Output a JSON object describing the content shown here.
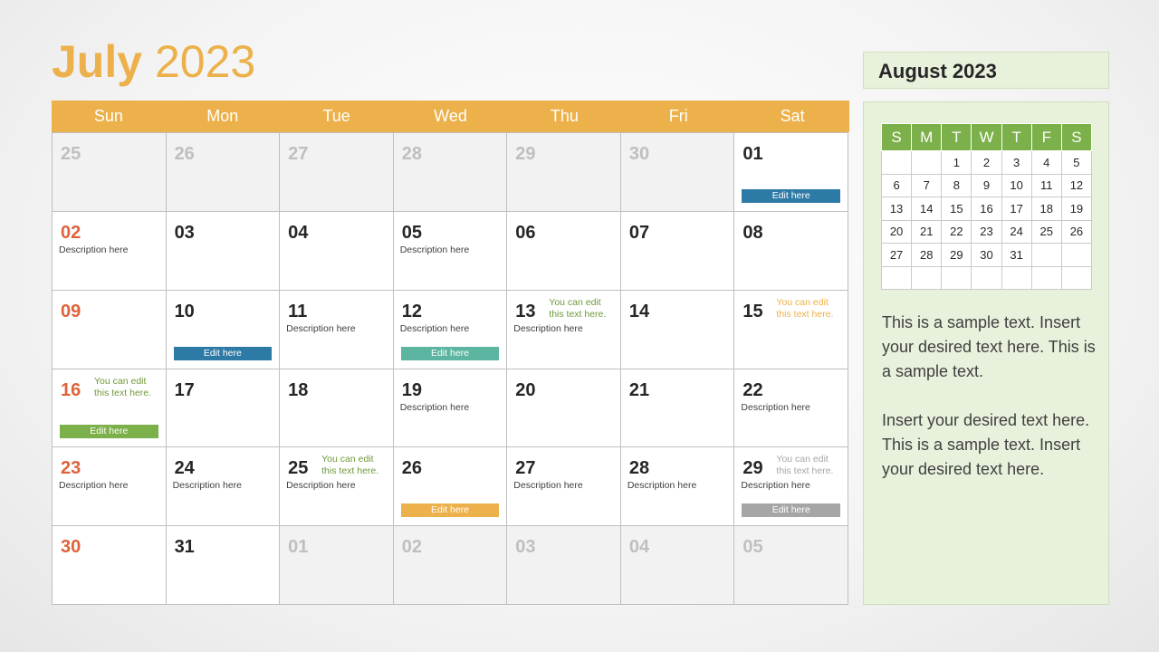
{
  "title": {
    "month": "July",
    "year": "2023"
  },
  "weekdays": [
    "Sun",
    "Mon",
    "Tue",
    "Wed",
    "Thu",
    "Fri",
    "Sat"
  ],
  "colors": {
    "orange": "#ecb14a",
    "sunday": "#e0623a",
    "blue": "#2e7aa6",
    "teal": "#5cb5a0",
    "green": "#7cb04a",
    "gray": "#a6a6a6",
    "note_green": "#6f9a3a",
    "note_orange": "#ecb14a",
    "note_gray": "#a6a6a6"
  },
  "calendar": {
    "weeks": [
      [
        {
          "day": "25",
          "other": true
        },
        {
          "day": "26",
          "other": true
        },
        {
          "day": "27",
          "other": true
        },
        {
          "day": "28",
          "other": true
        },
        {
          "day": "29",
          "other": true
        },
        {
          "day": "30",
          "other": true
        },
        {
          "day": "01",
          "edit": "Edit here",
          "edit_color": "blue"
        }
      ],
      [
        {
          "day": "02",
          "desc": "Description here"
        },
        {
          "day": "03"
        },
        {
          "day": "04"
        },
        {
          "day": "05",
          "desc": "Description here"
        },
        {
          "day": "06"
        },
        {
          "day": "07"
        },
        {
          "day": "08"
        }
      ],
      [
        {
          "day": "09"
        },
        {
          "day": "10",
          "edit": "Edit here",
          "edit_color": "blue"
        },
        {
          "day": "11",
          "desc": "Description here"
        },
        {
          "day": "12",
          "desc": "Description here",
          "edit": "Edit here",
          "edit_color": "teal"
        },
        {
          "day": "13",
          "desc": "Description here",
          "note": "You can edit this text here.",
          "note_color": "note_green"
        },
        {
          "day": "14"
        },
        {
          "day": "15",
          "note": "You can edit this text here.",
          "note_color": "note_orange"
        }
      ],
      [
        {
          "day": "16",
          "note": "You can edit this text here.",
          "note_color": "note_green",
          "edit": "Edit here",
          "edit_color": "green"
        },
        {
          "day": "17"
        },
        {
          "day": "18"
        },
        {
          "day": "19",
          "desc": "Description here"
        },
        {
          "day": "20"
        },
        {
          "day": "21"
        },
        {
          "day": "22",
          "desc": "Description here"
        }
      ],
      [
        {
          "day": "23",
          "desc": "Description here"
        },
        {
          "day": "24",
          "desc": "Description here"
        },
        {
          "day": "25",
          "desc": "Description here",
          "note": "You can edit this text here.",
          "note_color": "note_green"
        },
        {
          "day": "26",
          "edit": "Edit here",
          "edit_color": "orange"
        },
        {
          "day": "27",
          "desc": "Description here"
        },
        {
          "day": "28",
          "desc": "Description here"
        },
        {
          "day": "29",
          "desc": "Description here",
          "note": "You can edit this text here.",
          "note_color": "note_gray",
          "edit": "Edit here",
          "edit_color": "gray"
        }
      ],
      [
        {
          "day": "30"
        },
        {
          "day": "31"
        },
        {
          "day": "01",
          "other": true
        },
        {
          "day": "02",
          "other": true
        },
        {
          "day": "03",
          "other": true
        },
        {
          "day": "04",
          "other": true
        },
        {
          "day": "05",
          "other": true
        }
      ]
    ]
  },
  "side": {
    "title": "August 2023",
    "mini_headers": [
      "S",
      "M",
      "T",
      "W",
      "T",
      "F",
      "S"
    ],
    "mini_weeks": [
      [
        "",
        "",
        "1",
        "2",
        "3",
        "4",
        "5"
      ],
      [
        "6",
        "7",
        "8",
        "9",
        "10",
        "11",
        "12"
      ],
      [
        "13",
        "14",
        "15",
        "16",
        "17",
        "18",
        "19"
      ],
      [
        "20",
        "21",
        "22",
        "23",
        "24",
        "25",
        "26"
      ],
      [
        "27",
        "28",
        "29",
        "30",
        "31",
        "",
        ""
      ],
      [
        "",
        "",
        "",
        "",
        "",
        "",
        ""
      ]
    ],
    "paragraphs": [
      "This is a sample text. Insert your desired text here. This is a sample text.",
      "Insert your desired text here. This is a sample text. Insert your desired text here."
    ]
  }
}
